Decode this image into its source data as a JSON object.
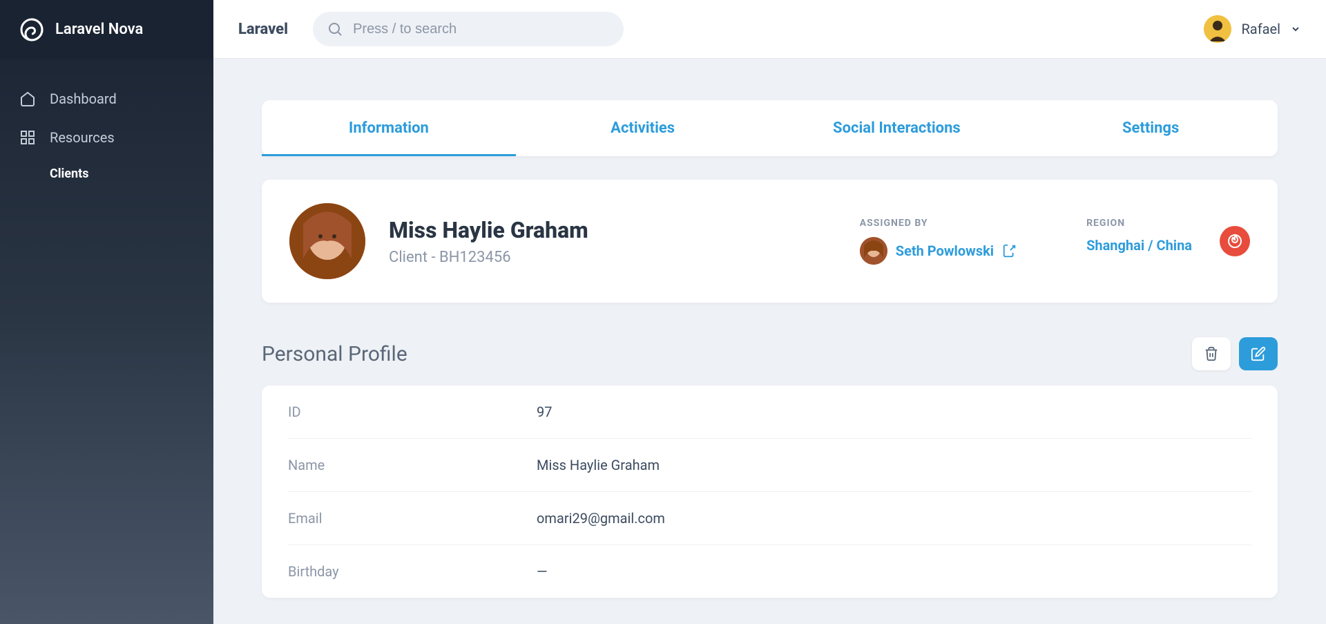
{
  "app_name": "Laravel Nova",
  "topbar": {
    "title": "Laravel",
    "search_placeholder": "Press / to search",
    "user": "Rafael"
  },
  "sidebar": {
    "items": [
      {
        "label": "Dashboard",
        "icon": "home"
      },
      {
        "label": "Resources",
        "icon": "grid"
      }
    ],
    "sub_items": [
      {
        "label": "Clients"
      }
    ]
  },
  "tabs": [
    {
      "label": "Information",
      "active": true
    },
    {
      "label": "Activities",
      "active": false
    },
    {
      "label": "Social Interactions",
      "active": false
    },
    {
      "label": "Settings",
      "active": false
    }
  ],
  "client": {
    "name": "Miss Haylie Graham",
    "subtitle": "Client - BH123456",
    "assigned_by_label": "Assigned By",
    "assigned_by": "Seth Powlowski",
    "region_label": "Region",
    "region": "Shanghai / China"
  },
  "section": {
    "title": "Personal Profile"
  },
  "fields": [
    {
      "label": "ID",
      "value": "97"
    },
    {
      "label": "Name",
      "value": "Miss Haylie Graham"
    },
    {
      "label": "Email",
      "value": "omari29@gmail.com"
    },
    {
      "label": "Birthday",
      "value": "—"
    }
  ]
}
